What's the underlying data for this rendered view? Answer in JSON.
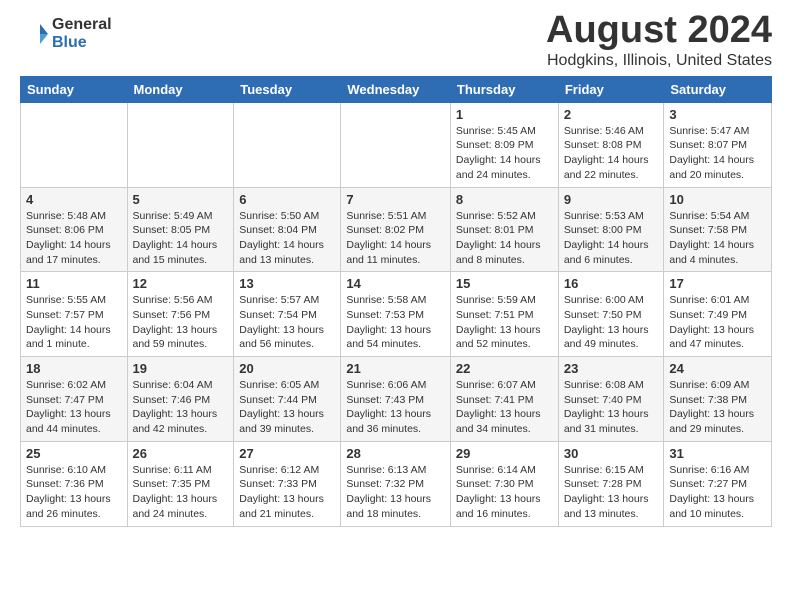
{
  "logo": {
    "general": "General",
    "blue": "Blue"
  },
  "title": "August 2024",
  "subtitle": "Hodgkins, Illinois, United States",
  "days_of_week": [
    "Sunday",
    "Monday",
    "Tuesday",
    "Wednesday",
    "Thursday",
    "Friday",
    "Saturday"
  ],
  "weeks": [
    [
      {
        "day": "",
        "info": ""
      },
      {
        "day": "",
        "info": ""
      },
      {
        "day": "",
        "info": ""
      },
      {
        "day": "",
        "info": ""
      },
      {
        "day": "1",
        "info": "Sunrise: 5:45 AM\nSunset: 8:09 PM\nDaylight: 14 hours and 24 minutes."
      },
      {
        "day": "2",
        "info": "Sunrise: 5:46 AM\nSunset: 8:08 PM\nDaylight: 14 hours and 22 minutes."
      },
      {
        "day": "3",
        "info": "Sunrise: 5:47 AM\nSunset: 8:07 PM\nDaylight: 14 hours and 20 minutes."
      }
    ],
    [
      {
        "day": "4",
        "info": "Sunrise: 5:48 AM\nSunset: 8:06 PM\nDaylight: 14 hours and 17 minutes."
      },
      {
        "day": "5",
        "info": "Sunrise: 5:49 AM\nSunset: 8:05 PM\nDaylight: 14 hours and 15 minutes."
      },
      {
        "day": "6",
        "info": "Sunrise: 5:50 AM\nSunset: 8:04 PM\nDaylight: 14 hours and 13 minutes."
      },
      {
        "day": "7",
        "info": "Sunrise: 5:51 AM\nSunset: 8:02 PM\nDaylight: 14 hours and 11 minutes."
      },
      {
        "day": "8",
        "info": "Sunrise: 5:52 AM\nSunset: 8:01 PM\nDaylight: 14 hours and 8 minutes."
      },
      {
        "day": "9",
        "info": "Sunrise: 5:53 AM\nSunset: 8:00 PM\nDaylight: 14 hours and 6 minutes."
      },
      {
        "day": "10",
        "info": "Sunrise: 5:54 AM\nSunset: 7:58 PM\nDaylight: 14 hours and 4 minutes."
      }
    ],
    [
      {
        "day": "11",
        "info": "Sunrise: 5:55 AM\nSunset: 7:57 PM\nDaylight: 14 hours and 1 minute."
      },
      {
        "day": "12",
        "info": "Sunrise: 5:56 AM\nSunset: 7:56 PM\nDaylight: 13 hours and 59 minutes."
      },
      {
        "day": "13",
        "info": "Sunrise: 5:57 AM\nSunset: 7:54 PM\nDaylight: 13 hours and 56 minutes."
      },
      {
        "day": "14",
        "info": "Sunrise: 5:58 AM\nSunset: 7:53 PM\nDaylight: 13 hours and 54 minutes."
      },
      {
        "day": "15",
        "info": "Sunrise: 5:59 AM\nSunset: 7:51 PM\nDaylight: 13 hours and 52 minutes."
      },
      {
        "day": "16",
        "info": "Sunrise: 6:00 AM\nSunset: 7:50 PM\nDaylight: 13 hours and 49 minutes."
      },
      {
        "day": "17",
        "info": "Sunrise: 6:01 AM\nSunset: 7:49 PM\nDaylight: 13 hours and 47 minutes."
      }
    ],
    [
      {
        "day": "18",
        "info": "Sunrise: 6:02 AM\nSunset: 7:47 PM\nDaylight: 13 hours and 44 minutes."
      },
      {
        "day": "19",
        "info": "Sunrise: 6:04 AM\nSunset: 7:46 PM\nDaylight: 13 hours and 42 minutes."
      },
      {
        "day": "20",
        "info": "Sunrise: 6:05 AM\nSunset: 7:44 PM\nDaylight: 13 hours and 39 minutes."
      },
      {
        "day": "21",
        "info": "Sunrise: 6:06 AM\nSunset: 7:43 PM\nDaylight: 13 hours and 36 minutes."
      },
      {
        "day": "22",
        "info": "Sunrise: 6:07 AM\nSunset: 7:41 PM\nDaylight: 13 hours and 34 minutes."
      },
      {
        "day": "23",
        "info": "Sunrise: 6:08 AM\nSunset: 7:40 PM\nDaylight: 13 hours and 31 minutes."
      },
      {
        "day": "24",
        "info": "Sunrise: 6:09 AM\nSunset: 7:38 PM\nDaylight: 13 hours and 29 minutes."
      }
    ],
    [
      {
        "day": "25",
        "info": "Sunrise: 6:10 AM\nSunset: 7:36 PM\nDaylight: 13 hours and 26 minutes."
      },
      {
        "day": "26",
        "info": "Sunrise: 6:11 AM\nSunset: 7:35 PM\nDaylight: 13 hours and 24 minutes."
      },
      {
        "day": "27",
        "info": "Sunrise: 6:12 AM\nSunset: 7:33 PM\nDaylight: 13 hours and 21 minutes."
      },
      {
        "day": "28",
        "info": "Sunrise: 6:13 AM\nSunset: 7:32 PM\nDaylight: 13 hours and 18 minutes."
      },
      {
        "day": "29",
        "info": "Sunrise: 6:14 AM\nSunset: 7:30 PM\nDaylight: 13 hours and 16 minutes."
      },
      {
        "day": "30",
        "info": "Sunrise: 6:15 AM\nSunset: 7:28 PM\nDaylight: 13 hours and 13 minutes."
      },
      {
        "day": "31",
        "info": "Sunrise: 6:16 AM\nSunset: 7:27 PM\nDaylight: 13 hours and 10 minutes."
      }
    ]
  ]
}
